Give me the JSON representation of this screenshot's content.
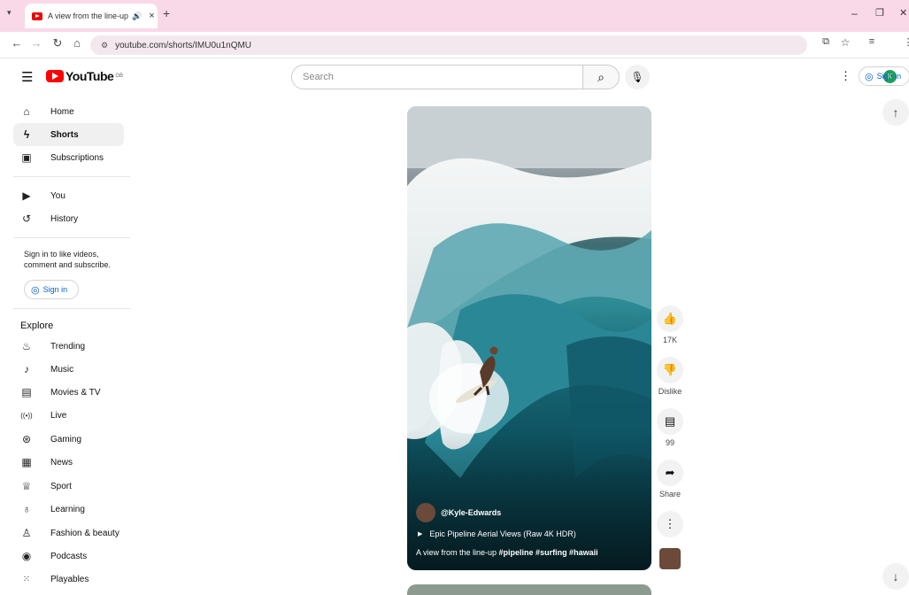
{
  "browser": {
    "tab_title": "A view from the line-up #pi",
    "tab_audio_icon": "speaker-icon",
    "url": "youtube.com/shorts/IMU0u1nQMU",
    "profile_initial": "K"
  },
  "masthead": {
    "logo_text": "YouTube",
    "logo_badge": "GB",
    "search_placeholder": "Search",
    "sign_in_label": "Sign in"
  },
  "sidebar": {
    "main": [
      {
        "label": "Home",
        "icon": "home-icon"
      },
      {
        "label": "Shorts",
        "icon": "shorts-icon"
      },
      {
        "label": "Subscriptions",
        "icon": "subscriptions-icon"
      }
    ],
    "you": [
      {
        "label": "You",
        "icon": "you-icon"
      },
      {
        "label": "History",
        "icon": "history-icon"
      }
    ],
    "signin_prompt": "Sign in to like videos, comment and subscribe.",
    "signin_button": "Sign in",
    "explore_title": "Explore",
    "explore": [
      {
        "label": "Trending",
        "icon": "trending-icon"
      },
      {
        "label": "Music",
        "icon": "music-icon"
      },
      {
        "label": "Movies & TV",
        "icon": "movies-icon"
      },
      {
        "label": "Live",
        "icon": "live-icon"
      },
      {
        "label": "Gaming",
        "icon": "gaming-icon"
      },
      {
        "label": "News",
        "icon": "news-icon"
      },
      {
        "label": "Sport",
        "icon": "sport-icon"
      },
      {
        "label": "Learning",
        "icon": "learning-icon"
      },
      {
        "label": "Fashion & beauty",
        "icon": "fashion-icon"
      },
      {
        "label": "Podcasts",
        "icon": "podcasts-icon"
      },
      {
        "label": "Playables",
        "icon": "playables-icon"
      }
    ]
  },
  "short": {
    "channel": "@Kyle-Edwards",
    "playlist_link": "Epic Pipeline Aerial Views (Raw 4K HDR)",
    "title_prefix": "A view from the line-up ",
    "hashtags": "#pipeline #surfing #hawaii"
  },
  "reactions": {
    "likes": "17K",
    "dislike_label": "Dislike",
    "comments": "99",
    "share_label": "Share"
  }
}
